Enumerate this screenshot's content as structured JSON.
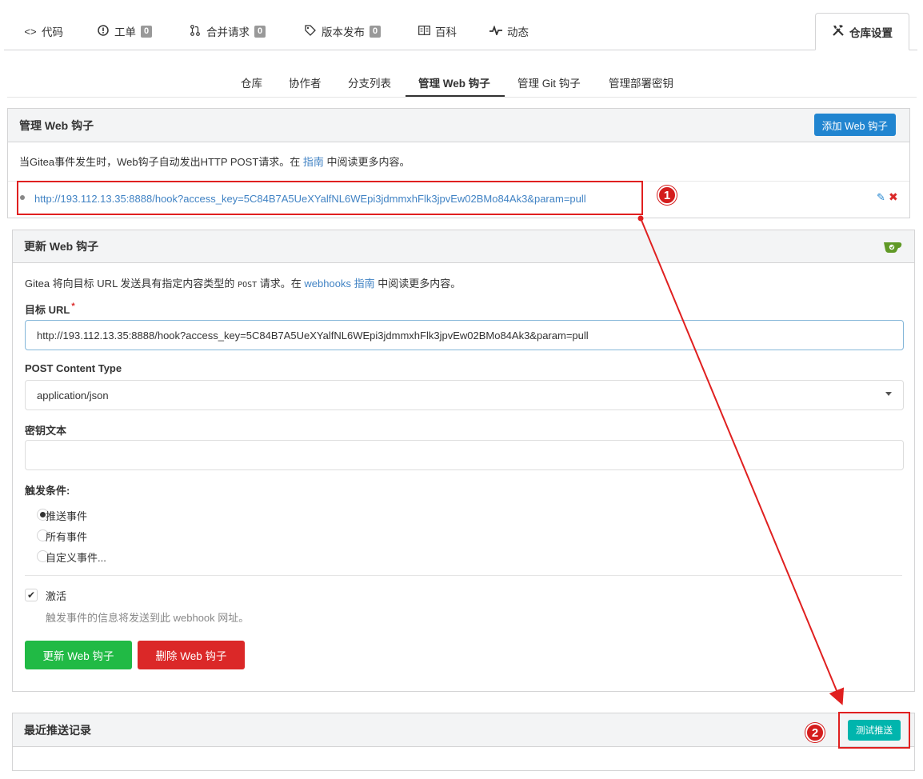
{
  "repo_tabs": {
    "code": {
      "label": "代码",
      "icon": "code-icon"
    },
    "issues": {
      "label": "工单",
      "count": "0",
      "icon": "issue-opened-icon"
    },
    "pulls": {
      "label": "合并请求",
      "count": "0",
      "icon": "git-pull-request-icon"
    },
    "releases": {
      "label": "版本发布",
      "count": "0",
      "icon": "tag-icon"
    },
    "wiki": {
      "label": "百科",
      "icon": "book-icon"
    },
    "activity": {
      "label": "动态",
      "icon": "pulse-icon"
    },
    "settings": {
      "label": "仓库设置",
      "icon": "tools-icon"
    }
  },
  "settings_nav": {
    "items": [
      "仓库",
      "协作者",
      "分支列表",
      "管理 Web 钩子",
      "管理 Git 钩子",
      "管理部署密钥"
    ],
    "active": "管理 Web 钩子"
  },
  "webhooks_panel": {
    "title": "管理 Web 钩子",
    "add_button": "添加 Web 钩子",
    "desc_before": "当Gitea事件发生时，Web钩子自动发出HTTP POST请求。在",
    "desc_link": "指南",
    "desc_after": "中阅读更多内容。",
    "hook_url": "http://193.112.13.35:8888/hook?access_key=5C84B7A5UeXYalfNL6WEpi3jdmmxhFlk3jpvEw02BMo84Ak3&param=pull"
  },
  "update_panel": {
    "title": "更新 Web 钩子",
    "desc_before": "Gitea 将向目标 URL 发送具有指定内容类型的",
    "desc_code": "POST",
    "desc_middle": "请求。在",
    "desc_link": "webhooks 指南",
    "desc_after": "中阅读更多内容。",
    "target_url_label": "目标 URL",
    "required_mark": "*",
    "target_url_value": "http://193.112.13.35:8888/hook?access_key=5C84B7A5UeXYalfNL6WEpi3jdmmxhFlk3jpvEw02BMo84Ak3&param=pull",
    "content_type_label": "POST Content Type",
    "content_type_value": "application/json",
    "secret_label": "密钥文本",
    "secret_value": "",
    "trigger_label": "触发条件:",
    "trigger_options": [
      "推送事件",
      "所有事件",
      "自定义事件..."
    ],
    "trigger_selected": "推送事件",
    "active_label": "激活",
    "active_checked": true,
    "active_help": "触发事件的信息将发送到此 webhook 网址。",
    "update_button": "更新 Web 钩子",
    "delete_button": "删除 Web 钩子"
  },
  "deliveries_panel": {
    "title": "最近推送记录",
    "test_button": "测试推送"
  },
  "annotations": {
    "badge_1": "1",
    "badge_2": "2"
  },
  "colors": {
    "link": "#4183c4",
    "primary": "#2185d0",
    "success": "#21ba45",
    "danger": "#db2828",
    "teal": "#00b5ad",
    "annotation_red": "#e02020"
  }
}
